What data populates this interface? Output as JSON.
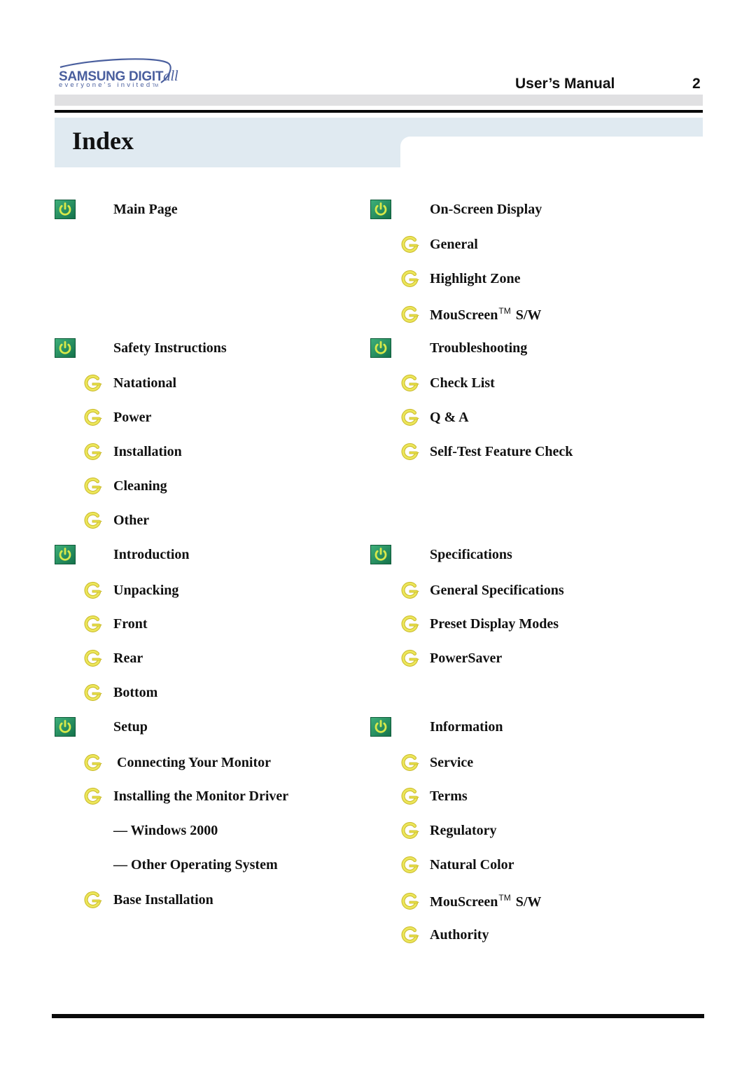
{
  "header": {
    "logo": {
      "brand": "SAMSUNG DIGIT",
      "brand_suffix": "all",
      "tagline": "everyone's invited",
      "tagline_tm": "TM"
    },
    "manual_title": "User’s Manual",
    "page_number": "2"
  },
  "index": {
    "title": "Index",
    "left_column": [
      {
        "type": "section",
        "label": "Main Page",
        "icon": "power-icon"
      },
      {
        "type": "section",
        "label": "Safety Instructions",
        "icon": "power-icon"
      },
      {
        "type": "item",
        "label": "Natational",
        "icon": "arrow-icon"
      },
      {
        "type": "item",
        "label": "Power",
        "icon": "arrow-icon"
      },
      {
        "type": "item",
        "label": "Installation",
        "icon": "arrow-icon"
      },
      {
        "type": "item",
        "label": "Cleaning",
        "icon": "arrow-icon"
      },
      {
        "type": "item",
        "label": "Other",
        "icon": "arrow-icon"
      },
      {
        "type": "section",
        "label": "Introduction",
        "icon": "power-icon"
      },
      {
        "type": "item",
        "label": "Unpacking",
        "icon": "arrow-icon"
      },
      {
        "type": "item",
        "label": "Front",
        "icon": "arrow-icon"
      },
      {
        "type": "item",
        "label": "Rear",
        "icon": "arrow-icon"
      },
      {
        "type": "item",
        "label": "Bottom",
        "icon": "arrow-icon"
      },
      {
        "type": "section",
        "label": "Setup",
        "icon": "power-icon"
      },
      {
        "type": "item",
        "label": " Connecting Your Monitor",
        "icon": "arrow-icon"
      },
      {
        "type": "item",
        "label": "Installing the Monitor Driver",
        "icon": "arrow-icon"
      },
      {
        "type": "subitem",
        "label": "— Windows 2000"
      },
      {
        "type": "subitem",
        "label": "— Other Operating System"
      },
      {
        "type": "item",
        "label": "Base Installation",
        "icon": "arrow-icon"
      }
    ],
    "right_column": [
      {
        "type": "section",
        "label": "On-Screen Display",
        "icon": "power-icon"
      },
      {
        "type": "item",
        "label": "General",
        "icon": "arrow-icon"
      },
      {
        "type": "item",
        "label": "Highlight Zone",
        "icon": "arrow-icon"
      },
      {
        "type": "item",
        "label": "MouScreen",
        "tm": "TM",
        "suffix": " S/W",
        "icon": "arrow-icon"
      },
      {
        "type": "section",
        "label": "Troubleshooting",
        "icon": "power-icon"
      },
      {
        "type": "item",
        "label": "Check List",
        "icon": "arrow-icon"
      },
      {
        "type": "item",
        "label": "Q & A",
        "icon": "arrow-icon"
      },
      {
        "type": "item",
        "label": "Self-Test Feature Check",
        "icon": "arrow-icon"
      },
      {
        "type": "section",
        "label": "Specifications",
        "icon": "power-icon"
      },
      {
        "type": "item",
        "label": "General Specifications",
        "icon": "arrow-icon"
      },
      {
        "type": "item",
        "label": "Preset Display Modes",
        "icon": "arrow-icon"
      },
      {
        "type": "item",
        "label": "PowerSaver",
        "icon": "arrow-icon"
      },
      {
        "type": "section",
        "label": "Information",
        "icon": "power-icon"
      },
      {
        "type": "item",
        "label": "Service",
        "icon": "arrow-icon"
      },
      {
        "type": "item",
        "label": "Terms",
        "icon": "arrow-icon"
      },
      {
        "type": "item",
        "label": "Regulatory",
        "icon": "arrow-icon"
      },
      {
        "type": "item",
        "label": "Natural Color",
        "icon": "arrow-icon"
      },
      {
        "type": "item",
        "label": "MouScreen",
        "tm": "TM",
        "suffix": " S/W",
        "icon": "arrow-icon"
      },
      {
        "type": "item",
        "label": "Authority",
        "icon": "arrow-icon"
      }
    ]
  },
  "colors": {
    "logo_blue": "#4a5f9e",
    "band_gray": "#e0e0e2",
    "band_blue": "#e0eaf1",
    "power_icon_green": "#1e8a5a",
    "power_icon_ring": "#d7e84a",
    "arrow_icon_yellow": "#e6e04a"
  }
}
